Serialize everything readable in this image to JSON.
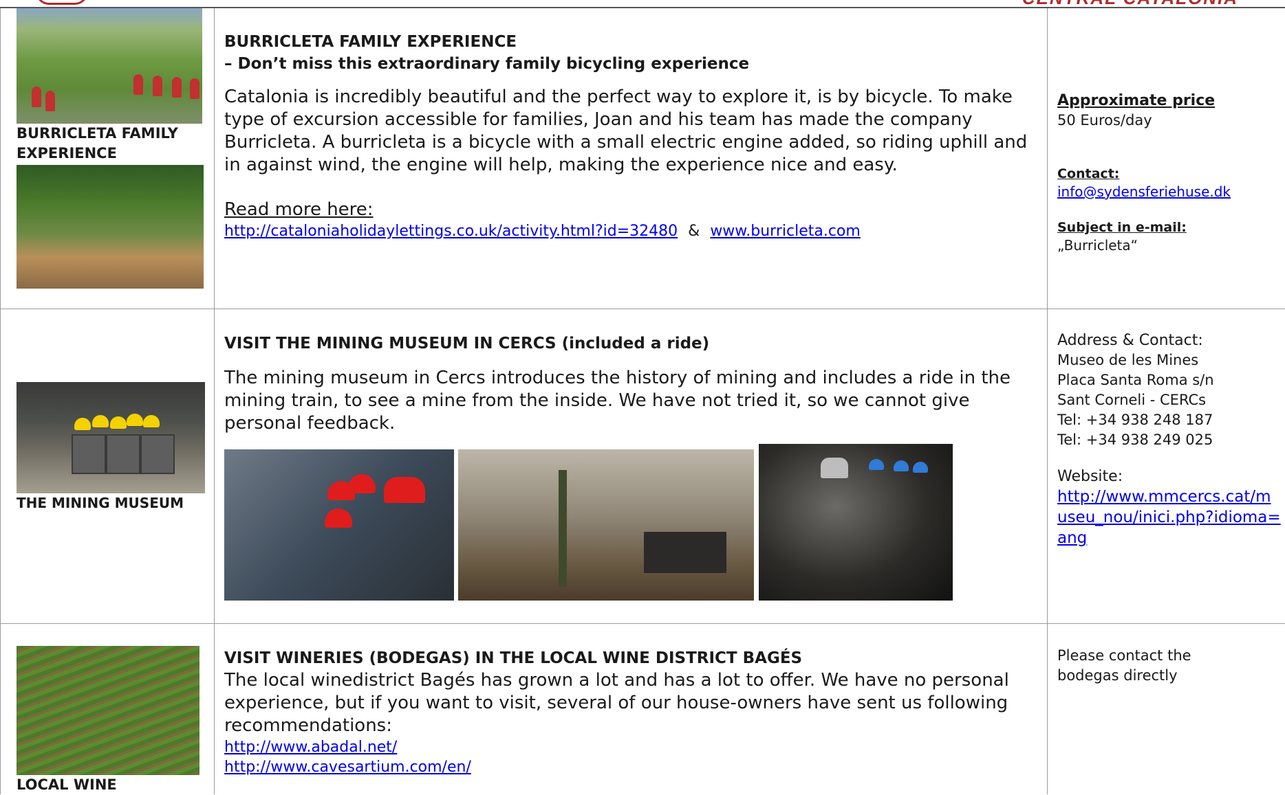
{
  "header": {
    "brand": "CENTRAL CATALONIA"
  },
  "rows": [
    {
      "caption": "BURRICLETA FAMILY EXPERIENCE",
      "title_line1": "BURRICLETA FAMILY EXPERIENCE",
      "title_line2": "– Don’t miss this extraordinary family bicycling experience",
      "body": "Catalonia is incredibly beautiful and the perfect way to explore it, is by bicycle.  To make type of excursion accessible for families, Joan and his team has made the company Burricleta. A burricleta is a bicycle with a small electric engine added, so riding uphill and in against wind, the engine will help, making the experience nice and easy.",
      "read_more": "Read more here:",
      "link1": "http://cataloniaholidaylettings.co.uk/activity.html?id=32480",
      "amp": "&",
      "link2": "www.burricleta.com",
      "side": {
        "price_label": "Approximate price",
        "price": "50 Euros/day",
        "contact_label": "Contact:",
        "contact_email": "info@sydensferiehuse.dk",
        "subject_label": "Subject in e-mail:",
        "subject": "„Burricleta“"
      }
    },
    {
      "caption": "THE MINING MUSEUM",
      "title": "VISIT THE MINING MUSEUM IN CERCS (included a ride)",
      "body": "The mining museum in Cercs introduces the history of mining and includes a ride in the mining train, to see a mine from the inside. We have not tried it, so we cannot give personal feedback.",
      "side": {
        "address_label": "Address & Contact:",
        "address_lines": [
          "Museo de les Mines",
          "Placa Santa Roma s/n",
          "Sant Corneli - CERCs",
          "Tel: +34 938 248 187",
          "Tel: +34 938 249 025"
        ],
        "website_label": "Website:",
        "website_lines": [
          "http://www.mmcercs.cat/m",
          "useu_nou/inici.php?idioma=",
          "ang"
        ]
      }
    },
    {
      "caption": "LOCAL WINE",
      "title": "VISIT WINERIES (BODEGAS) IN THE LOCAL WINE DISTRICT BAGÉS",
      "body": "The local winedistrict Bagés has grown a lot and has a lot to offer. We have no personal experience, but if you want to visit, several of our house-owners have sent us following recommendations:",
      "link1": "http://www.abadal.net/",
      "link2": "http://www.cavesartium.com/en/",
      "side": {
        "note": "Please contact the bodegas directly"
      }
    }
  ]
}
